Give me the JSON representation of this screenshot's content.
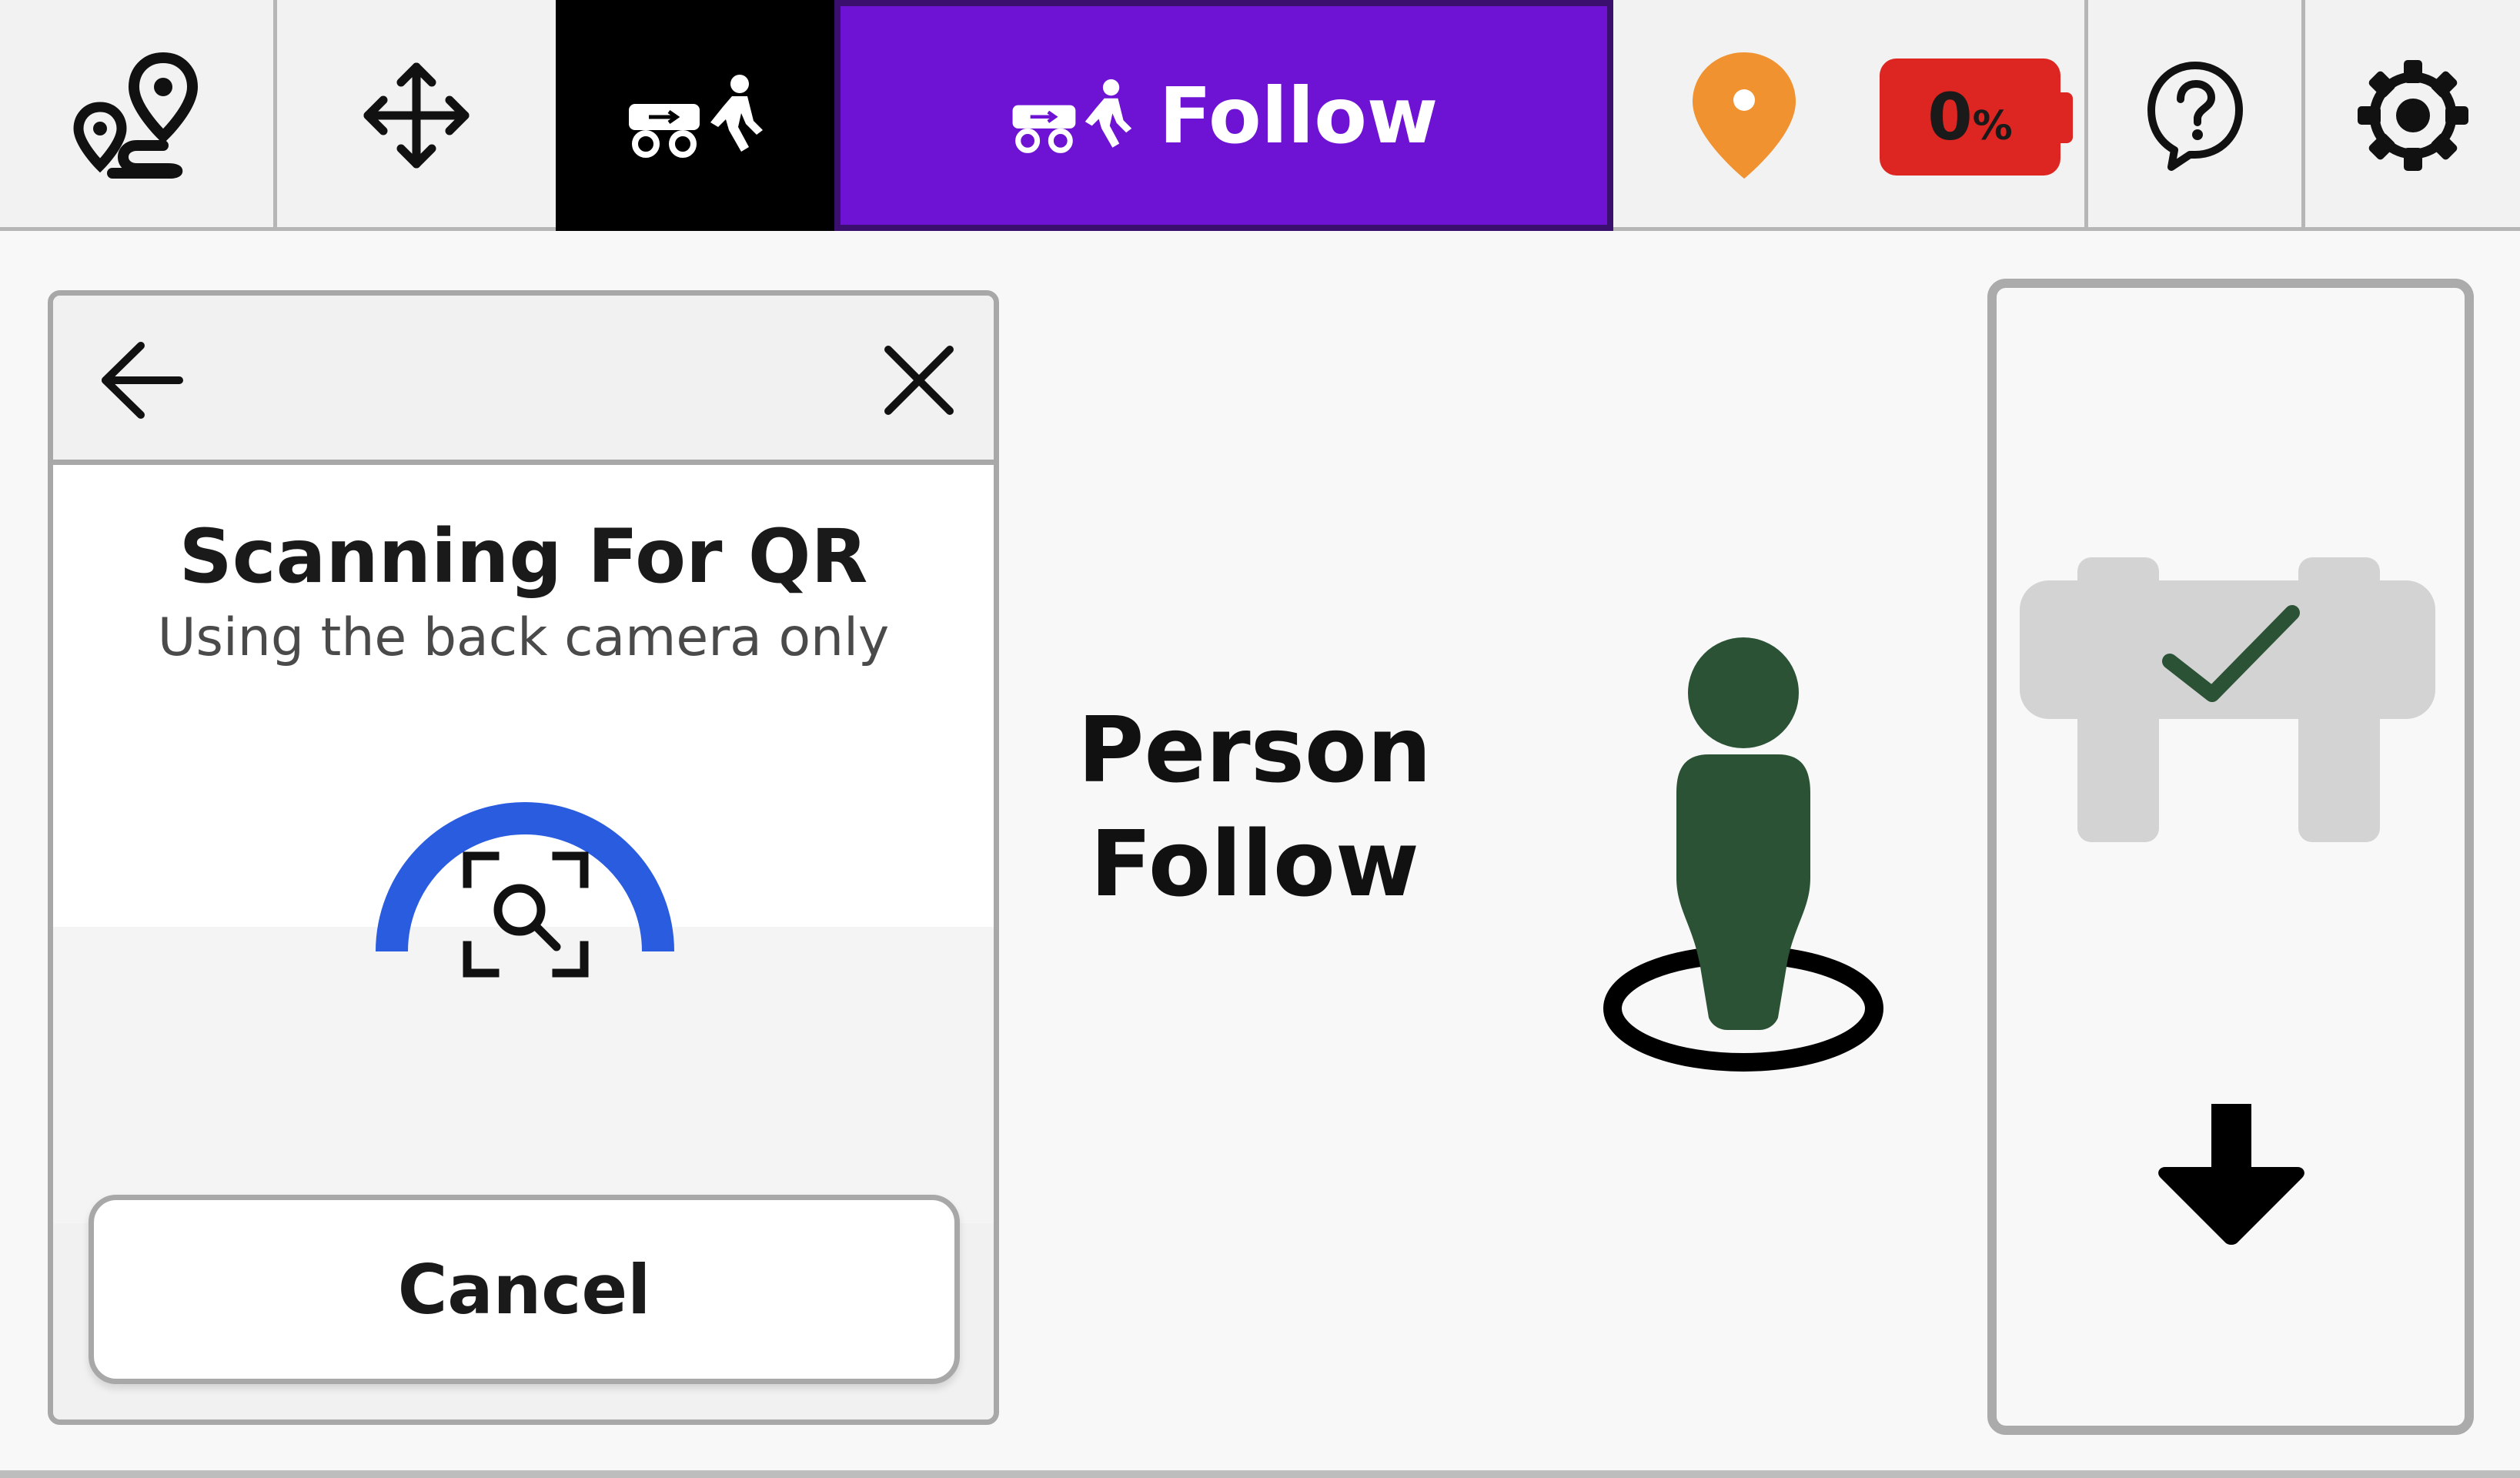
{
  "topbar": {
    "follow_label": "Follow",
    "battery": {
      "value": "0",
      "unit": "%",
      "level": 0
    },
    "active_color": "#6e12d4",
    "dark_tab_color": "#000000",
    "location_color": "#f0922f",
    "battery_color": "#dd2621"
  },
  "scan_panel": {
    "title": "Scanning For QR",
    "subtitle": "Using the back camera only",
    "cancel_label": "Cancel",
    "spinner_color": "#2a5ce0"
  },
  "main": {
    "mode_line1": "Person",
    "mode_line2": "Follow",
    "person_color": "#2c5236"
  },
  "icons": {
    "route": "route-icon",
    "move": "move-arrows-icon",
    "robot_person": "robot-follow-person-icon",
    "location": "location-pin-icon",
    "help": "help-bubble-icon",
    "settings": "gear-icon",
    "back": "back-arrow-icon",
    "close": "close-icon",
    "scan": "qr-scan-icon",
    "person": "person-standing-icon",
    "robot_check": "robot-checked-icon",
    "down": "down-arrow-icon"
  }
}
